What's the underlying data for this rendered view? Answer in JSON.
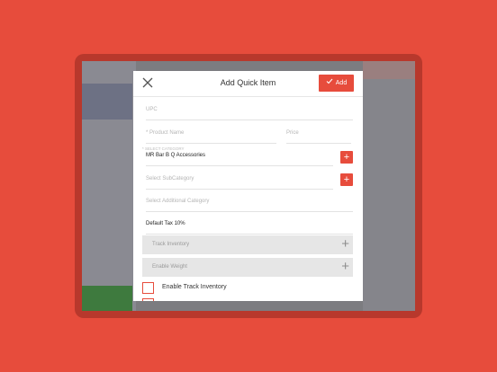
{
  "modal": {
    "title": "Add Quick Item",
    "add_label": "Add"
  },
  "fields": {
    "upc_placeholder": "UPC",
    "product_name_placeholder": "* Product Name",
    "price_placeholder": "Price",
    "category_label": "* SELECT CATEGORY",
    "category_value": "MR Bar B Q Accessories",
    "subcategory_placeholder": "Select SubCategory",
    "additional_category_placeholder": "Select Additional Category",
    "tax_value": "Default Tax 10%"
  },
  "toggles": {
    "track_inventory": "Track Inventory",
    "enable_weight": "Enable Weight"
  },
  "checkboxes": {
    "enable_track_inventory": "Enable Track Inventory"
  },
  "colors": {
    "accent": "#e74c3c",
    "background": "#e74c3c"
  },
  "icons": {
    "close": "close-icon",
    "check": "check-icon",
    "plus": "plus-icon"
  }
}
